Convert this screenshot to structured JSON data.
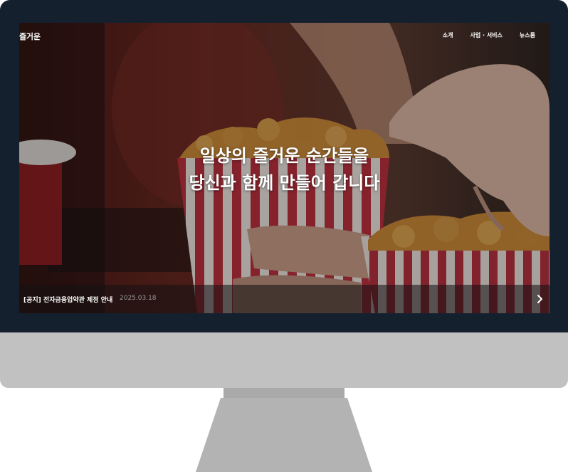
{
  "site": {
    "logo": "즐거운"
  },
  "nav": {
    "items": [
      "소개",
      "사업 · 서비스",
      "뉴스룸"
    ]
  },
  "hero": {
    "line1": "일상의 즐거운 순간들을",
    "line2": "당신과 함께 만들어 갑니다"
  },
  "notice": {
    "title": "[공지] 전자금융업약관 제정 안내",
    "date": "2025.03.18",
    "next_icon": "chevron-right-icon"
  },
  "colors": {
    "frame": "#15202e",
    "chin": "#c1c1c1",
    "stand": "#b3b3b3",
    "popcorn_stripe": "#c23a4a"
  }
}
